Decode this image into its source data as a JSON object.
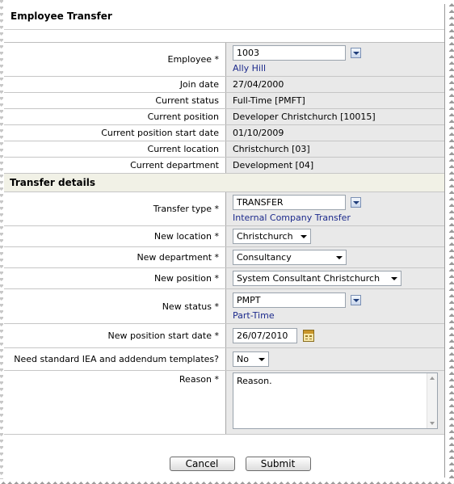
{
  "form": {
    "title": "Employee Transfer",
    "employee": {
      "label": "Employee *",
      "code": "1003",
      "name": "Ally Hill"
    },
    "info_rows": [
      {
        "label": "Join date",
        "value": "27/04/2000"
      },
      {
        "label": "Current status",
        "value": "Full-Time [PMFT]"
      },
      {
        "label": "Current position",
        "value": "Developer Christchurch [10015]"
      },
      {
        "label": "Current position start date",
        "value": "01/10/2009"
      },
      {
        "label": "Current location",
        "value": "Christchurch [03]"
      },
      {
        "label": "Current department",
        "value": "Development [04]"
      }
    ],
    "transfer_section": "Transfer details",
    "transfer_type": {
      "label": "Transfer type *",
      "code": "TRANSFER",
      "description": "Internal Company Transfer"
    },
    "new_location": {
      "label": "New location *",
      "value": "Christchurch"
    },
    "new_department": {
      "label": "New department *",
      "value": "Consultancy"
    },
    "new_position": {
      "label": "New position *",
      "value": "System Consultant Christchurch"
    },
    "new_status": {
      "label": "New status *",
      "code": "PMPT",
      "description": "Part-Time"
    },
    "new_start_date": {
      "label": "New position start date *",
      "value": "26/07/2010"
    },
    "templates": {
      "label": "Need standard IEA and addendum templates?",
      "value": "No"
    },
    "reason": {
      "label": "Reason *",
      "value": "Reason."
    },
    "buttons": {
      "cancel": "Cancel",
      "submit": "Submit"
    }
  },
  "colors": {
    "value_bg": "#e9e9e9",
    "section_bg": "#f1f1e6",
    "link_blue": "#1c2a8c"
  }
}
